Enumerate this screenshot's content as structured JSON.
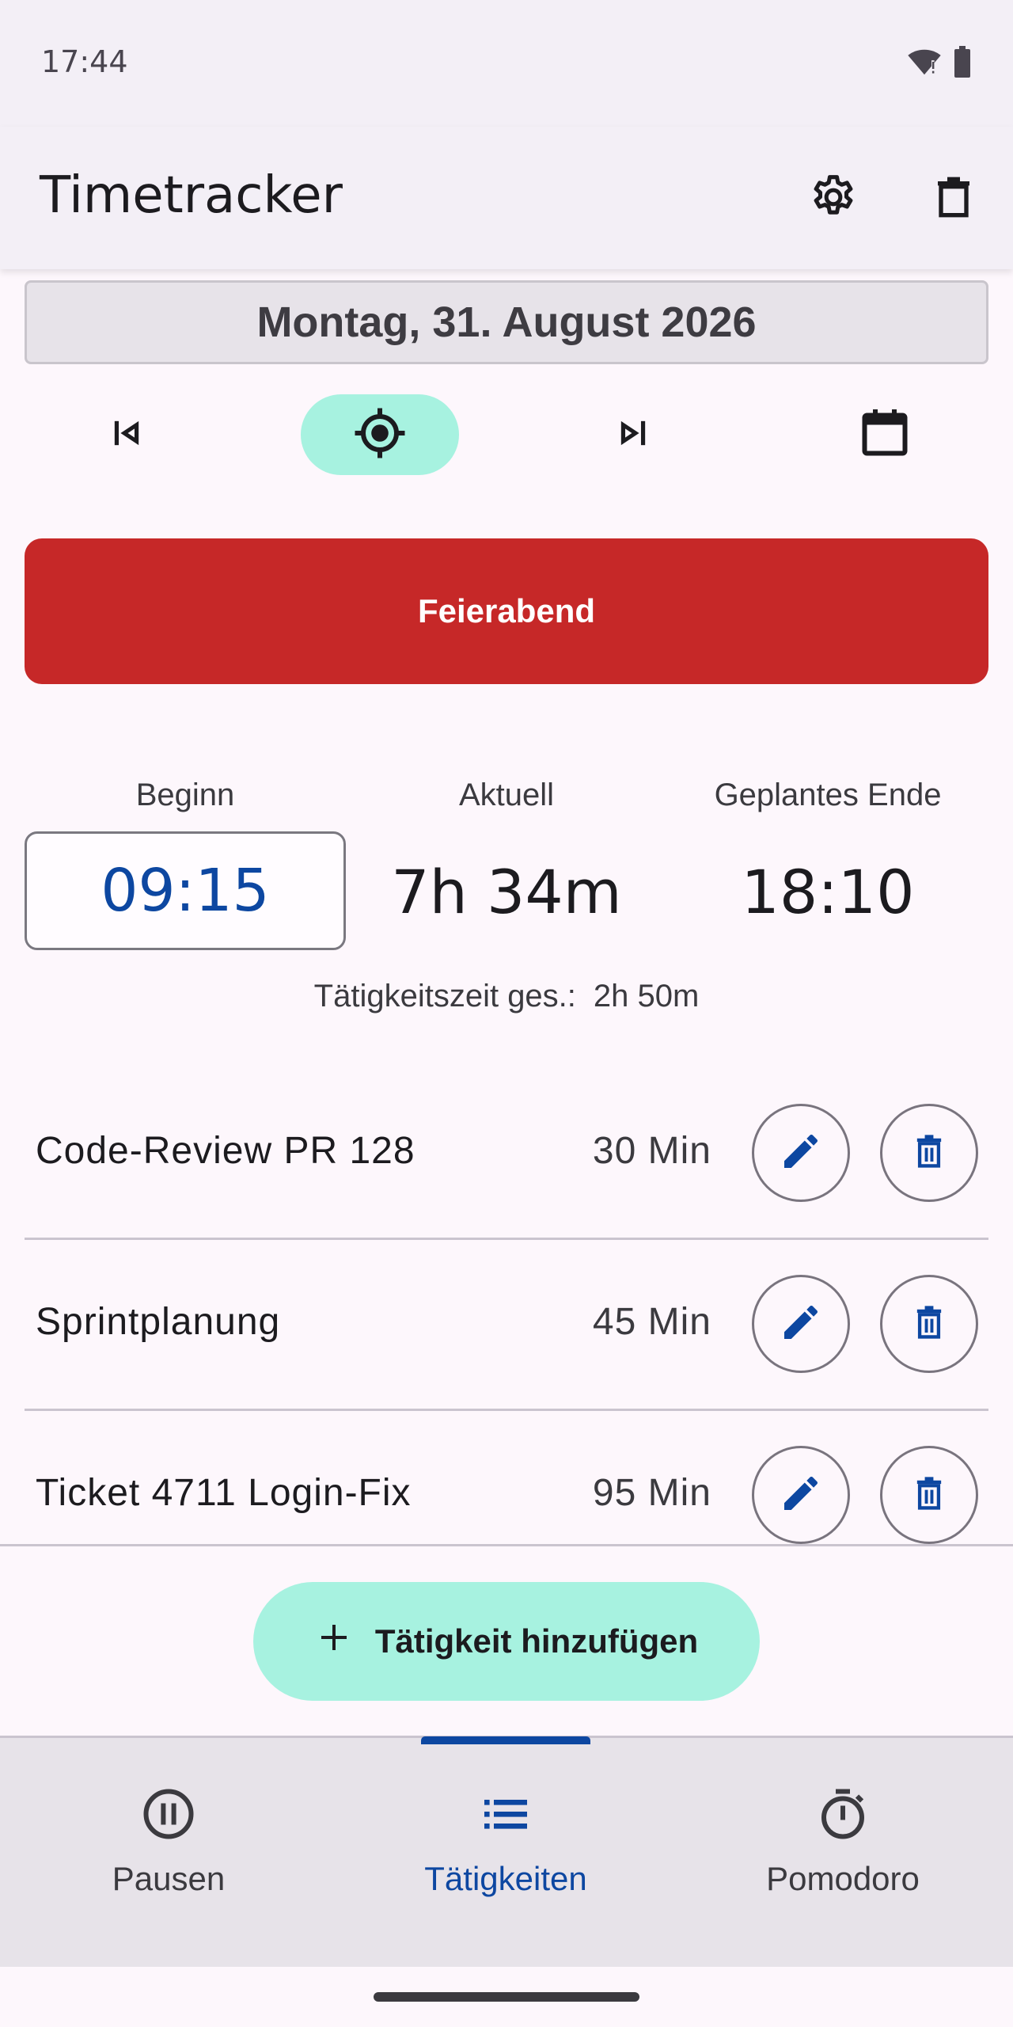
{
  "status_bar": {
    "time": "17:44"
  },
  "app_bar": {
    "title": "Timetracker",
    "settings_icon": "gear-icon",
    "delete_icon": "trash-icon"
  },
  "date": {
    "label": "Montag, 31. August 2026"
  },
  "date_nav": {
    "prev_icon": "skip-previous-icon",
    "today_icon": "target-icon",
    "next_icon": "skip-next-icon",
    "calendar_icon": "calendar-icon"
  },
  "end_button": {
    "label": "Feierabend",
    "color": "#c62828"
  },
  "stats": {
    "begin_label": "Beginn",
    "begin_value": "09:15",
    "current_label": "Aktuell",
    "current_value": "7h 34m",
    "end_label": "Geplantes Ende",
    "end_value": "18:10"
  },
  "total": {
    "label": "Tätigkeitszeit ges.:",
    "value": "2h 50m"
  },
  "activities": [
    {
      "name": "Code-Review PR 128",
      "minutes": "30 Min"
    },
    {
      "name": "Sprintplanung",
      "minutes": "45 Min"
    },
    {
      "name": "Ticket 4711 Login-Fix",
      "minutes": "95 Min"
    }
  ],
  "add_button": {
    "label": "Tätigkeit hinzufügen",
    "icon": "plus-icon"
  },
  "bottom_nav": {
    "items": [
      {
        "label": "Pausen",
        "icon": "pause-circle-icon"
      },
      {
        "label": "Tätigkeiten",
        "icon": "list-icon",
        "active": true
      },
      {
        "label": "Pomodoro",
        "icon": "timer-icon"
      }
    ]
  },
  "colors": {
    "accent": "#0d47a1",
    "mint": "#a7f2e0",
    "danger": "#c62828"
  }
}
